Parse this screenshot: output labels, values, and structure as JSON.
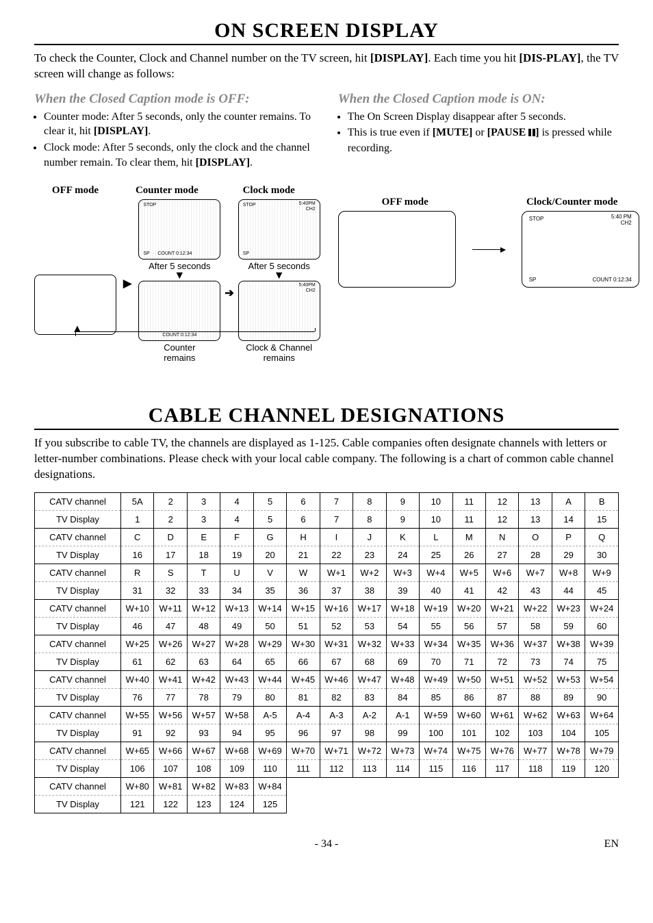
{
  "section1": {
    "title": "ON SCREEN DISPLAY",
    "intro_a": "To check the Counter, Clock and Channel number on the TV screen, hit ",
    "display1": "[DISPLAY]",
    "intro_b": ". Each time you hit ",
    "display2": "[DIS-PLAY]",
    "intro_c": ", the TV screen will change as follows:",
    "off": {
      "heading": "When the Closed Caption mode is OFF:",
      "li1a": "Counter mode: After 5 seconds, only the counter remains. To clear it, hit ",
      "li1b": "[DISPLAY]",
      "li1c": ".",
      "li2a": "Clock mode: After 5 seconds, only the clock and the channel number remain. To clear them, hit ",
      "li2b": "[DISPLAY]",
      "li2c": "."
    },
    "on": {
      "heading": "When the Closed Caption mode is ON:",
      "li1": "The On Screen Display disappear after 5 seconds.",
      "li2a": "This is true even if ",
      "mute": "[MUTE]",
      "li2b": " or ",
      "pause": "[PAUSE ",
      "pause_suffix": "]",
      "li2c": " is pressed while recording."
    },
    "modes": {
      "off_label": "OFF mode",
      "counter_label": "Counter mode",
      "clock_label": "Clock mode",
      "on_off_label": "OFF mode",
      "on_clock_label": "Clock/Counter mode",
      "tv_stop": "STOP",
      "tv_time": "5:40PM",
      "tv_time_sp": "5:40 PM",
      "tv_ch": "CH2",
      "tv_sp": "SP",
      "tv_count": "COUNT 0:12:34",
      "tv_count_sp": "COUNT  0:12:34",
      "after5": "After 5 seconds",
      "counter_remains": "Counter",
      "counter_remains2": "remains",
      "clock_remains": "Clock & Channel",
      "clock_remains2": "remains"
    }
  },
  "section2": {
    "title": "CABLE CHANNEL DESIGNATIONS",
    "intro": "If you subscribe to cable TV, the channels are displayed as 1-125. Cable companies often designate channels with letters or letter-number combinations. Please check with your local cable company. The following is a chart of common cable channel designations.",
    "row_labels": {
      "catv": "CATV channel",
      "tv": "TV Display"
    },
    "rows": [
      {
        "catv": [
          "5A",
          "2",
          "3",
          "4",
          "5",
          "6",
          "7",
          "8",
          "9",
          "10",
          "11",
          "12",
          "13",
          "A",
          "B"
        ],
        "tv": [
          "1",
          "2",
          "3",
          "4",
          "5",
          "6",
          "7",
          "8",
          "9",
          "10",
          "11",
          "12",
          "13",
          "14",
          "15"
        ]
      },
      {
        "catv": [
          "C",
          "D",
          "E",
          "F",
          "G",
          "H",
          "I",
          "J",
          "K",
          "L",
          "M",
          "N",
          "O",
          "P",
          "Q"
        ],
        "tv": [
          "16",
          "17",
          "18",
          "19",
          "20",
          "21",
          "22",
          "23",
          "24",
          "25",
          "26",
          "27",
          "28",
          "29",
          "30"
        ]
      },
      {
        "catv": [
          "R",
          "S",
          "T",
          "U",
          "V",
          "W",
          "W+1",
          "W+2",
          "W+3",
          "W+4",
          "W+5",
          "W+6",
          "W+7",
          "W+8",
          "W+9"
        ],
        "tv": [
          "31",
          "32",
          "33",
          "34",
          "35",
          "36",
          "37",
          "38",
          "39",
          "40",
          "41",
          "42",
          "43",
          "44",
          "45"
        ]
      },
      {
        "catv": [
          "W+10",
          "W+11",
          "W+12",
          "W+13",
          "W+14",
          "W+15",
          "W+16",
          "W+17",
          "W+18",
          "W+19",
          "W+20",
          "W+21",
          "W+22",
          "W+23",
          "W+24"
        ],
        "tv": [
          "46",
          "47",
          "48",
          "49",
          "50",
          "51",
          "52",
          "53",
          "54",
          "55",
          "56",
          "57",
          "58",
          "59",
          "60"
        ]
      },
      {
        "catv": [
          "W+25",
          "W+26",
          "W+27",
          "W+28",
          "W+29",
          "W+30",
          "W+31",
          "W+32",
          "W+33",
          "W+34",
          "W+35",
          "W+36",
          "W+37",
          "W+38",
          "W+39"
        ],
        "tv": [
          "61",
          "62",
          "63",
          "64",
          "65",
          "66",
          "67",
          "68",
          "69",
          "70",
          "71",
          "72",
          "73",
          "74",
          "75"
        ]
      },
      {
        "catv": [
          "W+40",
          "W+41",
          "W+42",
          "W+43",
          "W+44",
          "W+45",
          "W+46",
          "W+47",
          "W+48",
          "W+49",
          "W+50",
          "W+51",
          "W+52",
          "W+53",
          "W+54"
        ],
        "tv": [
          "76",
          "77",
          "78",
          "79",
          "80",
          "81",
          "82",
          "83",
          "84",
          "85",
          "86",
          "87",
          "88",
          "89",
          "90"
        ]
      },
      {
        "catv": [
          "W+55",
          "W+56",
          "W+57",
          "W+58",
          "A-5",
          "A-4",
          "A-3",
          "A-2",
          "A-1",
          "W+59",
          "W+60",
          "W+61",
          "W+62",
          "W+63",
          "W+64"
        ],
        "tv": [
          "91",
          "92",
          "93",
          "94",
          "95",
          "96",
          "97",
          "98",
          "99",
          "100",
          "101",
          "102",
          "103",
          "104",
          "105"
        ]
      },
      {
        "catv": [
          "W+65",
          "W+66",
          "W+67",
          "W+68",
          "W+69",
          "W+70",
          "W+71",
          "W+72",
          "W+73",
          "W+74",
          "W+75",
          "W+76",
          "W+77",
          "W+78",
          "W+79"
        ],
        "tv": [
          "106",
          "107",
          "108",
          "109",
          "110",
          "111",
          "112",
          "113",
          "114",
          "115",
          "116",
          "117",
          "118",
          "119",
          "120"
        ]
      },
      {
        "catv": [
          "W+80",
          "W+81",
          "W+82",
          "W+83",
          "W+84"
        ],
        "tv": [
          "121",
          "122",
          "123",
          "124",
          "125"
        ]
      }
    ]
  },
  "footer": {
    "page": "- 34 -",
    "lang": "EN"
  }
}
